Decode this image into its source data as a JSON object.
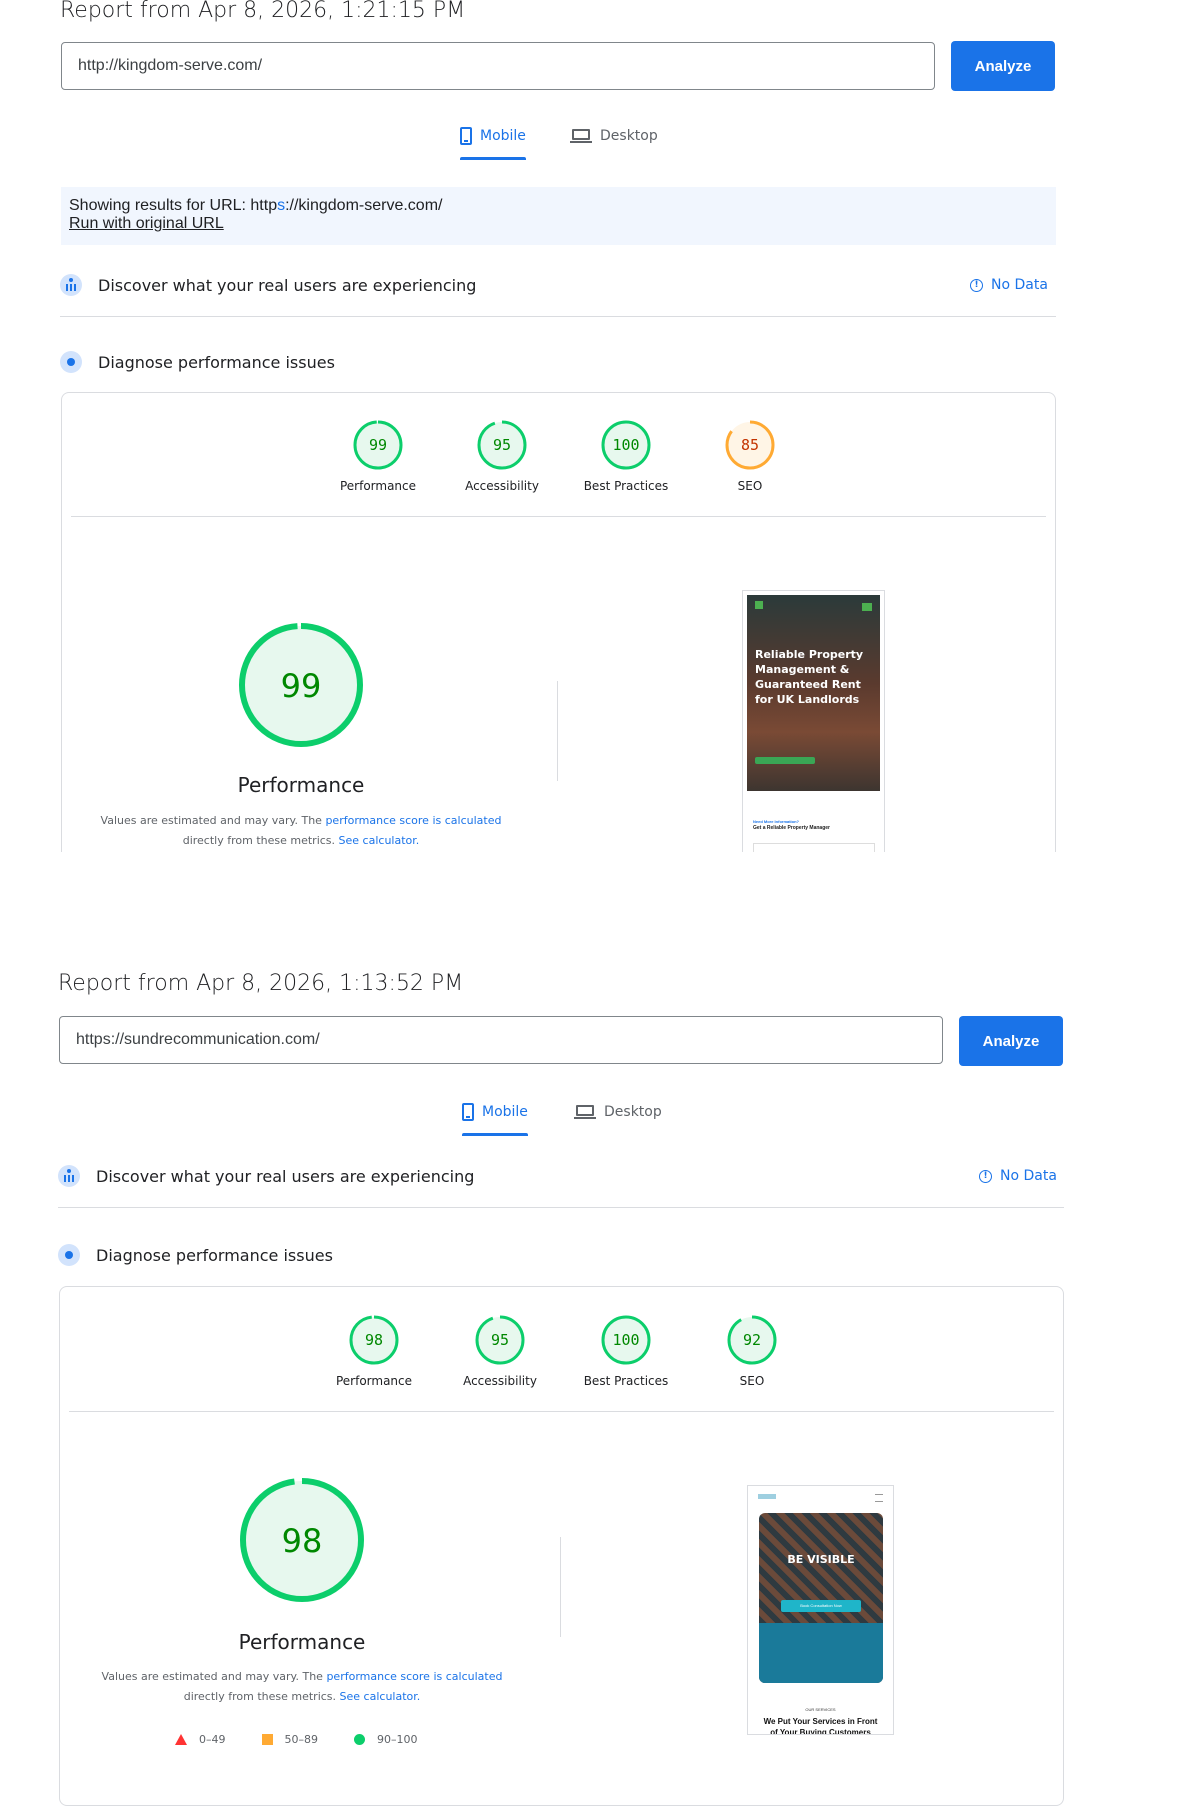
{
  "report1": {
    "title": "Report from Apr 8, 2026, 1:21:15 PM",
    "url": "http://kingdom-serve.com/",
    "analyze": "Analyze",
    "tabs": {
      "mobile": "Mobile",
      "desktop": "Desktop"
    },
    "notice": {
      "prefix": "Showing results for URL: http",
      "highlight": "s",
      "suffix": "://kingdom-serve.com/",
      "link": "Run with original URL"
    },
    "field_section": {
      "title": "Discover what your real users are experiencing",
      "status": "No Data"
    },
    "diagnose_section": {
      "title": "Diagnose performance issues"
    },
    "scores": [
      {
        "label": "Performance",
        "value": "99",
        "color": "#0cce6b"
      },
      {
        "label": "Accessibility",
        "value": "95",
        "color": "#0cce6b"
      },
      {
        "label": "Best Practices",
        "value": "100",
        "color": "#0cce6b"
      },
      {
        "label": "SEO",
        "value": "85",
        "color": "#ffaa33"
      }
    ],
    "main_score": "99",
    "main_label": "Performance",
    "note": {
      "text1": "Values are estimated and may vary. The ",
      "link1": "performance score is calculated",
      "text2": "directly from these metrics. ",
      "link2": "See calculator."
    },
    "screenshot": {
      "hero_title": "Reliable Property Management & Guaranteed Rent for UK Landlords",
      "form_kicker": "Need More Information?",
      "form_title": "Get a Reliable Property Manager"
    }
  },
  "report2": {
    "title": "Report from Apr 8, 2026, 1:13:52 PM",
    "url": "https://sundrecommunication.com/",
    "analyze": "Analyze",
    "tabs": {
      "mobile": "Mobile",
      "desktop": "Desktop"
    },
    "field_section": {
      "title": "Discover what your real users are experiencing",
      "status": "No Data"
    },
    "diagnose_section": {
      "title": "Diagnose performance issues"
    },
    "scores": [
      {
        "label": "Performance",
        "value": "98",
        "color": "#0cce6b"
      },
      {
        "label": "Accessibility",
        "value": "95",
        "color": "#0cce6b"
      },
      {
        "label": "Best Practices",
        "value": "100",
        "color": "#0cce6b"
      },
      {
        "label": "SEO",
        "value": "92",
        "color": "#0cce6b"
      }
    ],
    "main_score": "98",
    "main_label": "Performance",
    "note": {
      "text1": "Values are estimated and may vary. The ",
      "link1": "performance score is calculated",
      "text2": "directly from these metrics. ",
      "link2": "See calculator."
    },
    "screenshot": {
      "hero_title": "BE VISIBLE",
      "cta": "Book Consultation Now",
      "services_kicker": "OUR SERVICES",
      "services_title": "We Put Your Services in Front of Your Buying Customers"
    },
    "legend": [
      "0–49",
      "50–89",
      "90–100"
    ]
  }
}
